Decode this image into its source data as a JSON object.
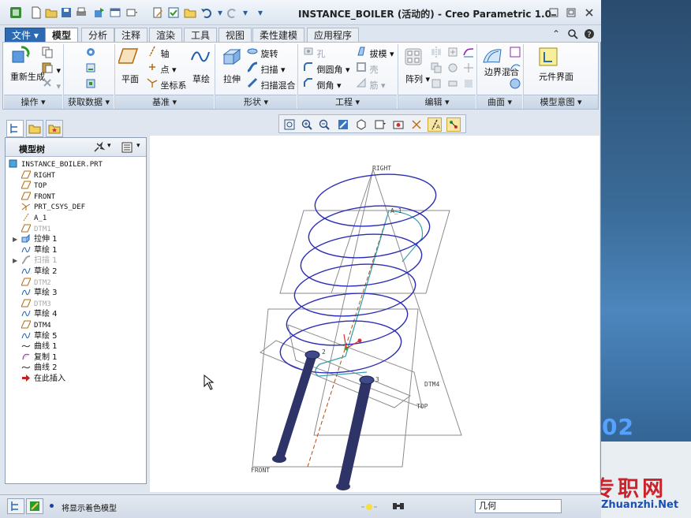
{
  "window": {
    "title": "INSTANCE_BOILER (活动的) - Creo Parametric 1.0"
  },
  "tabs": [
    {
      "label": "文件",
      "state": "file"
    },
    {
      "label": "模型",
      "state": "active"
    },
    {
      "label": "分析"
    },
    {
      "label": "注释"
    },
    {
      "label": "渲染"
    },
    {
      "label": "工具"
    },
    {
      "label": "视图"
    },
    {
      "label": "柔性建模"
    },
    {
      "label": "应用程序"
    }
  ],
  "ribbon": {
    "groups": [
      "操作",
      "获取数据",
      "基准",
      "形状",
      "工程",
      "编辑",
      "曲面",
      "模型意图"
    ],
    "regen": "重新生成",
    "plane": "平面",
    "axis": "轴",
    "point": "点",
    "csys": "坐标系",
    "sketch": "草绘",
    "extrude": "拉伸",
    "revolve": "旋转",
    "sweep": "扫描",
    "swept_blend": "扫描混合",
    "hole": "孔",
    "round": "倒圆角",
    "chamfer": "倒角",
    "draft": "拔模",
    "shell": "壳",
    "rib": "筋",
    "pattern": "阵列",
    "boundary_blend": "边界混合",
    "component_interface": "元件界面"
  },
  "model_tree": {
    "title": "模型树",
    "items": [
      {
        "label": "INSTANCE_BOILER.PRT",
        "icon": "part-icon",
        "dim": false
      },
      {
        "label": "RIGHT",
        "icon": "datum-plane-icon",
        "dim": false
      },
      {
        "label": "TOP",
        "icon": "datum-plane-icon",
        "dim": false
      },
      {
        "label": "FRONT",
        "icon": "datum-plane-icon",
        "dim": false
      },
      {
        "label": "PRT_CSYS_DEF",
        "icon": "csys-icon",
        "dim": false
      },
      {
        "label": "A_1",
        "icon": "axis-icon",
        "dim": false
      },
      {
        "label": "DTM1",
        "icon": "datum-plane-icon",
        "dim": true
      },
      {
        "label": "拉伸 1",
        "icon": "extrude-icon",
        "dim": false,
        "expandable": true
      },
      {
        "label": "草绘 1",
        "icon": "sketch-icon",
        "dim": false
      },
      {
        "label": "扫描 1",
        "icon": "sweep-icon",
        "dim": true,
        "expandable": true
      },
      {
        "label": "草绘 2",
        "icon": "sketch-icon",
        "dim": false
      },
      {
        "label": "DTM2",
        "icon": "datum-plane-icon",
        "dim": true
      },
      {
        "label": "草绘 3",
        "icon": "sketch-icon",
        "dim": false
      },
      {
        "label": "DTM3",
        "icon": "datum-plane-icon",
        "dim": true
      },
      {
        "label": "草绘 4",
        "icon": "sketch-icon",
        "dim": false
      },
      {
        "label": "DTM4",
        "icon": "datum-plane-icon",
        "dim": false
      },
      {
        "label": "草绘 5",
        "icon": "sketch-icon",
        "dim": false
      },
      {
        "label": "曲线 1",
        "icon": "curve-icon",
        "dim": false
      },
      {
        "label": "复制 1",
        "icon": "copy-icon",
        "dim": false
      },
      {
        "label": "曲线 2",
        "icon": "curve-icon",
        "dim": false
      },
      {
        "label": "在此插入",
        "icon": "insert-here-icon",
        "dim": false
      }
    ]
  },
  "graphics": {
    "labels": {
      "right": "RIGHT",
      "top": "TOP",
      "front": "FRONT",
      "dtm4": "DTM4",
      "a1": "A_1",
      "n2": "2",
      "n3": "3"
    }
  },
  "status": {
    "message": "将显示着色模型",
    "filter": "几何"
  },
  "watermark": {
    "number": "02",
    "site_cn": "专职网",
    "site_url": "Zhuanzhi.Net"
  },
  "colors": {
    "helix": "#2b2db6",
    "pipe": "#2e3468",
    "datum": "#8b8b8b",
    "accent": "#2d6ab1"
  }
}
